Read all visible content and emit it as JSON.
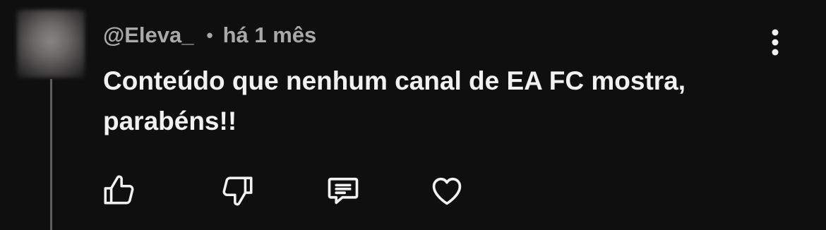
{
  "comment": {
    "author": "@Eleva_",
    "separator": "•",
    "time": "há 1 mês",
    "text": "Conteúdo que nenhum canal de EA FC mostra, parabéns!!"
  },
  "icons": {
    "menu": "more-vertical-icon",
    "like": "thumbs-up-icon",
    "dislike": "thumbs-down-icon",
    "reply": "comment-icon",
    "heart": "heart-icon"
  },
  "colors": {
    "background": "#0f0f0f",
    "meta_text": "#aaaaaa",
    "body_text": "#f1f1f1",
    "icon": "#f1f1f1",
    "thread_line": "#5e5e5e"
  }
}
